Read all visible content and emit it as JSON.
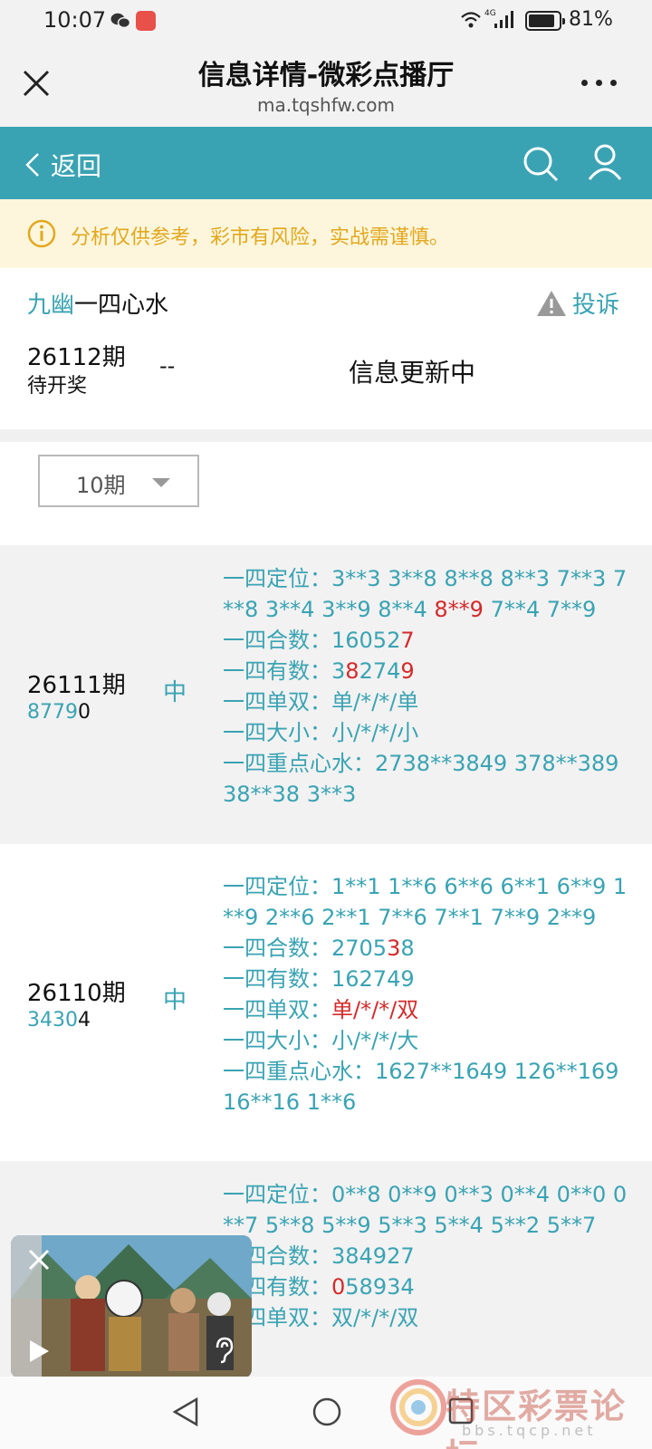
{
  "status_bar": {
    "time": "10:07",
    "battery_percent": "81%",
    "network": "4G"
  },
  "title_bar": {
    "title": "信息详情-微彩点播厅",
    "url": "ma.tqshfw.com"
  },
  "nav": {
    "back_label": "返回",
    "accent_color": "#3aa3b3"
  },
  "notice": {
    "text": "分析仅供参考，彩市有风险，实战需谨慎。"
  },
  "info": {
    "author_name": "九幽",
    "plan_title": "一四心水",
    "complain_label": "投诉",
    "current_issue": "26112期",
    "current_status": "待开奖",
    "current_dash": "--",
    "update_text": "信息更新中"
  },
  "filter": {
    "selected": "10期"
  },
  "records": [
    {
      "issue": "26111期",
      "draw_head": "8779",
      "draw_tail": "0",
      "result": "中",
      "lines": [
        [
          {
            "t": "一四定位：3**3 3**8 8**8 8**3 7**3 7**8 3**4 3**9 8**4 "
          },
          {
            "t": "8**9",
            "r": true
          },
          {
            "t": " 7**4 7**9"
          }
        ],
        [
          {
            "t": "一四合数：16052"
          },
          {
            "t": "7",
            "r": true
          }
        ],
        [
          {
            "t": "一四有数：3"
          },
          {
            "t": "8",
            "r": true
          },
          {
            "t": "274"
          },
          {
            "t": "9",
            "r": true
          }
        ],
        [
          {
            "t": "一四单双：单/*/*/单"
          }
        ],
        [
          {
            "t": "一四大小：小/*/*/小"
          }
        ],
        [
          {
            "t": "一四重点心水：2738**3849 378**389 38**38 3**3"
          }
        ]
      ]
    },
    {
      "issue": "26110期",
      "draw_head": "3430",
      "draw_tail": "4",
      "result": "中",
      "lines": [
        [
          {
            "t": "一四定位：1**1 1**6 6**6 6**1 6**9 1**9 2**6 2**1 7**6 7**1 7**9 2**9"
          }
        ],
        [
          {
            "t": "一四合数：2705"
          },
          {
            "t": "3",
            "r": true
          },
          {
            "t": "8"
          }
        ],
        [
          {
            "t": "一四有数：162749"
          }
        ],
        [
          {
            "t": "一四单双："
          },
          {
            "t": "单/*/*/双",
            "r": true
          }
        ],
        [
          {
            "t": "一四大小：小/*/*/大"
          }
        ],
        [
          {
            "t": "一四重点心水：1627**1649 126**169 16**16 1**6"
          }
        ]
      ]
    },
    {
      "issue": "",
      "draw_head": "",
      "draw_tail": "",
      "result": "",
      "lines": [
        [
          {
            "t": "一四定位：0**8 0**9 0**3 0**4 0**0 0**7 5**8 5**9 5**3 5**4 5**2 5**7"
          }
        ],
        [
          {
            "t": "一四合数：384927"
          }
        ],
        [
          {
            "t": "一四有数："
          },
          {
            "t": "0",
            "r": true
          },
          {
            "t": "58934"
          }
        ],
        [
          {
            "t": "一四单双：双/*/*/双"
          }
        ]
      ]
    }
  ],
  "watermark": {
    "text": "特区彩票论坛",
    "sub": "bbs.tqcp.net"
  }
}
